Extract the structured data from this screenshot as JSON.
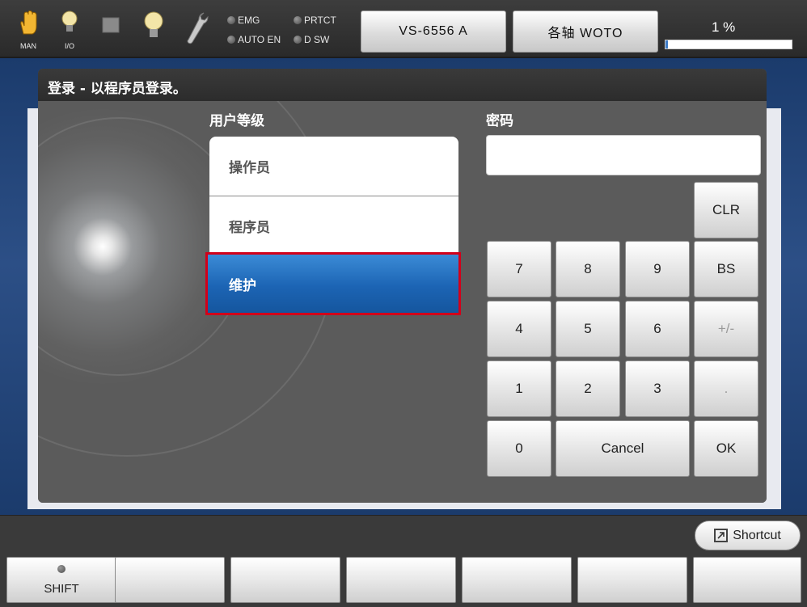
{
  "topbar": {
    "icons": [
      {
        "name": "hand-icon",
        "caption": "MAN"
      },
      {
        "name": "io-bulb-icon",
        "caption": "I/O"
      },
      {
        "name": "stop-square-icon",
        "caption": ""
      },
      {
        "name": "bulb-icon",
        "caption": ""
      },
      {
        "name": "wrench-icon",
        "caption": ""
      }
    ],
    "lamps": {
      "emg": "EMG",
      "prtct": "PRTCT",
      "auto_en": "AUTO EN",
      "d_sw": "D SW"
    },
    "robot_model": "VS-6556 A",
    "axis_mode": "各轴 WOTO",
    "speed_text": "1 %",
    "speed_fraction": 0.01
  },
  "dialog": {
    "title": "登录 - 以程序员登录。",
    "user_level_label": "用户等级",
    "password_label": "密码",
    "levels": [
      "操作员",
      "程序员",
      "维护"
    ],
    "selected_level": "维护",
    "password_value": ""
  },
  "keypad": {
    "clr": "CLR",
    "k7": "7",
    "k8": "8",
    "k9": "9",
    "bs": "BS",
    "k4": "4",
    "k5": "5",
    "k6": "6",
    "sign": "+/-",
    "k1": "1",
    "k2": "2",
    "k3": "3",
    "dot": ".",
    "k0": "0",
    "cancel": "Cancel",
    "ok": "OK"
  },
  "bottom": {
    "shortcut_label": "Shortcut",
    "shift_label": "SHIFT"
  },
  "colors": {
    "selected_blue": "#1c64b4",
    "highlight_red": "#d2001a",
    "background_blue": "#2c4f86"
  }
}
